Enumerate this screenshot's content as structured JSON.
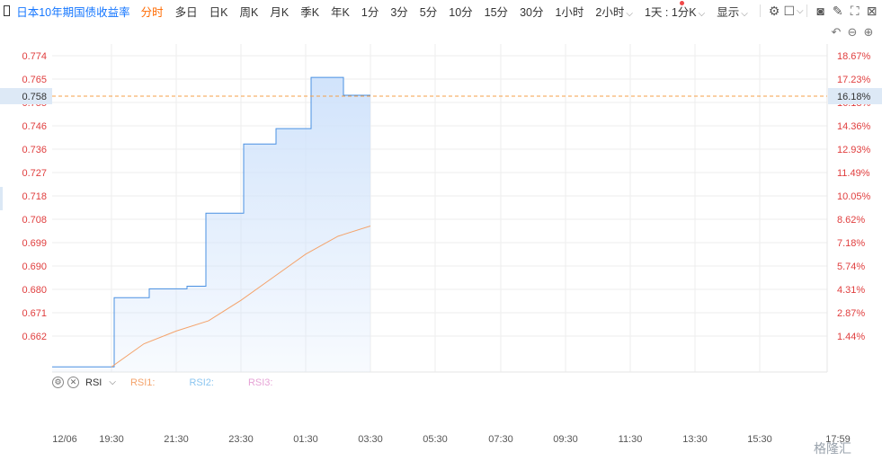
{
  "toolbar": {
    "symbol": "日本10年期国债收益率",
    "tabs": [
      "分时",
      "多日",
      "日K",
      "周K",
      "月K",
      "季K",
      "年K",
      "1分",
      "3分",
      "5分",
      "10分",
      "15分",
      "30分",
      "1小时"
    ],
    "active_tab": "分时",
    "tab_2h": "2小时",
    "tab_cycle": "1天 : 1分K",
    "display_label": "显示",
    "icons": [
      "settings-icon",
      "square-icon",
      "camera-icon",
      "pencil-icon",
      "fullscreen-icon",
      "close-icon"
    ]
  },
  "chart_tools": [
    "undo-icon",
    "zoom-out-icon",
    "zoom-in-icon"
  ],
  "colors": {
    "price_line": "#4a90e2",
    "area_fill": "#cfe2fb",
    "rsi_line": "#f4a36b",
    "axis_text_red": "#e03e3e",
    "dashed_line": "#f5a048",
    "grid": "#eeeeee"
  },
  "chart_data": {
    "type": "line",
    "y_left_ticks": [
      "0.774",
      "0.765",
      "0.755",
      "0.746",
      "0.736",
      "0.727",
      "0.718",
      "0.708",
      "0.699",
      "0.690",
      "0.680",
      "0.671",
      "0.662"
    ],
    "y_right_ticks": [
      "18.67%",
      "17.23%",
      "16.18%",
      "14.36%",
      "12.93%",
      "11.49%",
      "10.05%",
      "8.62%",
      "7.18%",
      "5.74%",
      "4.31%",
      "2.87%",
      "1.44%"
    ],
    "x_ticks": [
      "12/06",
      "19:30",
      "21:30",
      "23:30",
      "01:30",
      "03:30",
      "05:30",
      "07:30",
      "09:30",
      "11:30",
      "13:30",
      "15:30",
      "17:59"
    ],
    "current_price_label": "0.758",
    "current_pct_label": "16.18%",
    "ylim": [
      0.6505,
      0.7785
    ],
    "price_series": {
      "x_time": [
        "17:59",
        "19:30",
        "19:35",
        "20:40",
        "21:50",
        "22:25",
        "23:35",
        "00:35",
        "01:40",
        "02:40",
        "03:30"
      ],
      "values": [
        0.6525,
        0.6525,
        0.6795,
        0.683,
        0.684,
        0.7125,
        0.7395,
        0.7455,
        0.7655,
        0.7585,
        0.7585
      ]
    },
    "indicator": {
      "name": "RSI",
      "labels": [
        "RSI1:",
        "RSI2:",
        "RSI3:"
      ],
      "label_colors": [
        "#f4a36b",
        "#8cc6f0",
        "#e6a3d6"
      ],
      "rsi1_x_time": [
        "19:30",
        "20:30",
        "21:30",
        "22:30",
        "23:30",
        "00:30",
        "01:30",
        "02:30",
        "03:30"
      ],
      "rsi1_values": [
        0.6525,
        0.6615,
        0.6665,
        0.6705,
        0.6785,
        0.6875,
        0.6965,
        0.7035,
        0.7075
      ]
    }
  },
  "watermark": "格隆汇"
}
